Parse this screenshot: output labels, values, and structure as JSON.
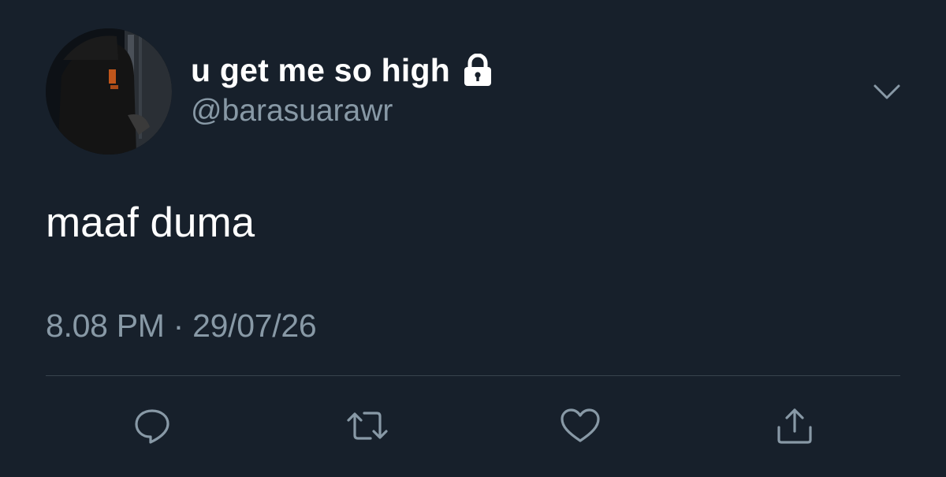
{
  "colors": {
    "background": "#17202b",
    "primary_text": "#ffffff",
    "secondary_text": "#8899a6",
    "divider": "#38444d",
    "icon": "#8899a6"
  },
  "user": {
    "display_name": "u get me so high",
    "handle": "@barasuarawr",
    "protected_icon": "lock-icon",
    "avatar_icon": "avatar"
  },
  "tweet": {
    "text": "maaf duma",
    "timestamp": "8.08 PM · 29/07/26"
  },
  "menu_icon": "chevron-down-icon",
  "actions": [
    {
      "name": "reply",
      "icon": "reply-icon"
    },
    {
      "name": "retweet",
      "icon": "retweet-icon"
    },
    {
      "name": "like",
      "icon": "heart-icon"
    },
    {
      "name": "share",
      "icon": "share-icon"
    }
  ]
}
